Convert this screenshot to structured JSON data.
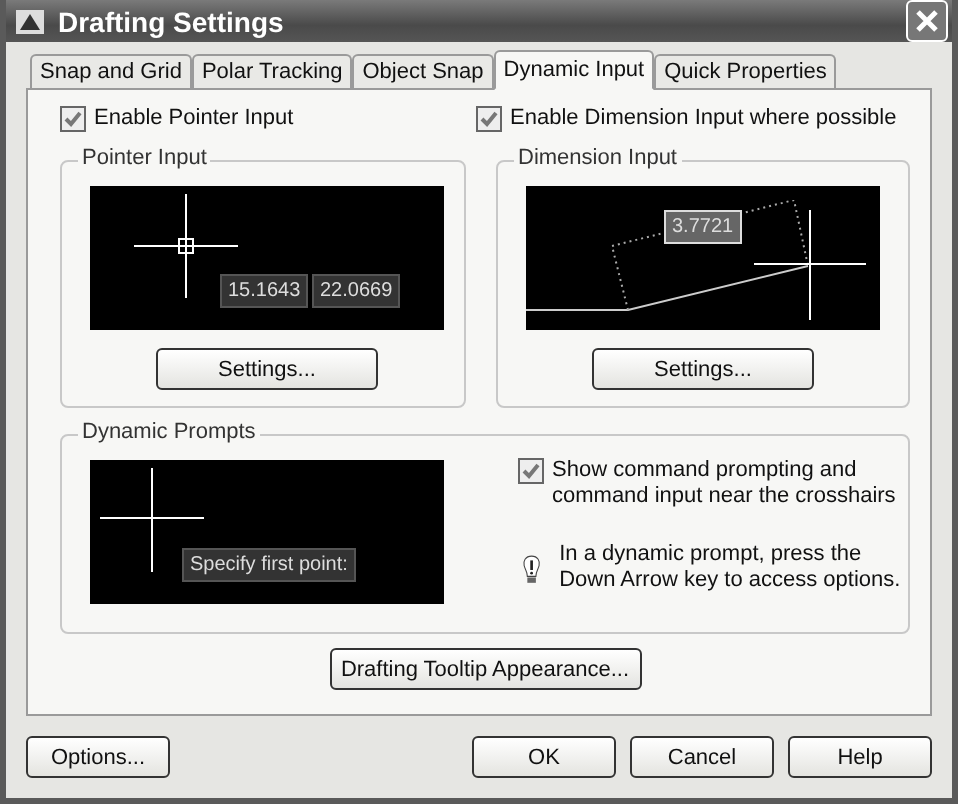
{
  "window": {
    "title": "Drafting Settings"
  },
  "tabs": [
    {
      "label": "Snap and Grid",
      "selected": false
    },
    {
      "label": "Polar Tracking",
      "selected": false
    },
    {
      "label": "Object Snap",
      "selected": false
    },
    {
      "label": "Dynamic Input",
      "selected": true
    },
    {
      "label": "Quick Properties",
      "selected": false
    }
  ],
  "pointer_input": {
    "enable": {
      "label": "Enable Pointer Input",
      "checked": true
    },
    "group_title": "Pointer Input",
    "preview_values": [
      "15.1643",
      "22.0669"
    ],
    "button": "Settings..."
  },
  "dimension_input": {
    "enable": {
      "label": "Enable Dimension Input where possible",
      "checked": true
    },
    "group_title": "Dimension Input",
    "preview_value": "3.7721",
    "button": "Settings..."
  },
  "dynamic_prompts": {
    "group_title": "Dynamic Prompts",
    "preview_prompt": "Specify first point:",
    "show_prompting": {
      "label": "Show command prompting and command input near the crosshairs",
      "checked": true
    },
    "tip": "In a dynamic prompt, press the Down Arrow key to access options."
  },
  "tooltip_button": "Drafting Tooltip Appearance...",
  "buttons": {
    "options": "Options...",
    "ok": "OK",
    "cancel": "Cancel",
    "help": "Help"
  }
}
